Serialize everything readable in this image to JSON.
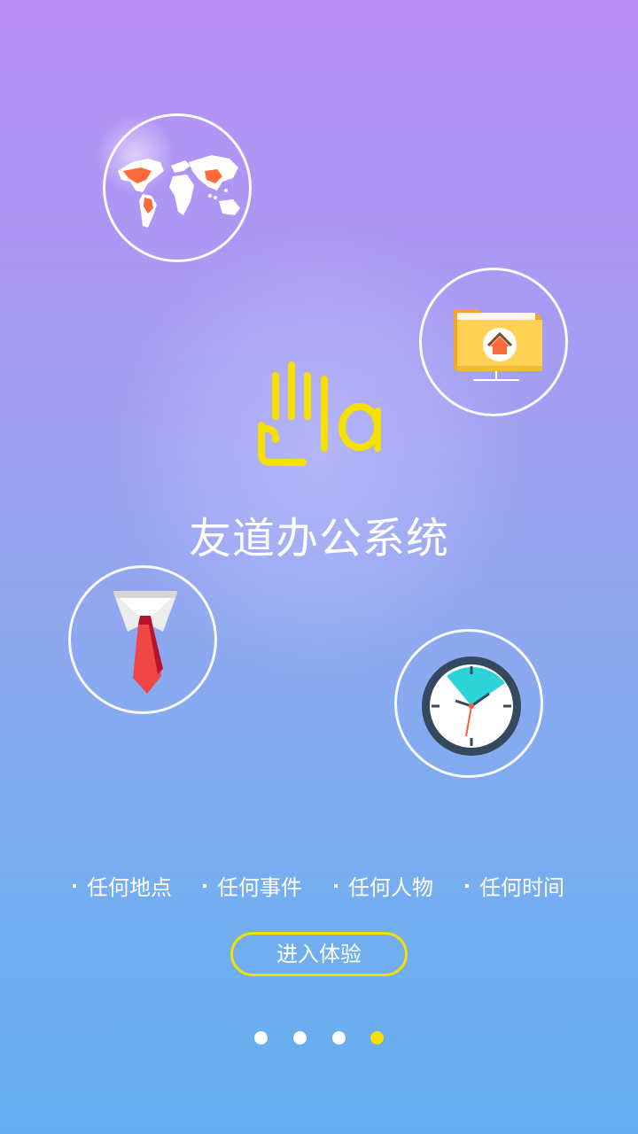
{
  "app": {
    "title": "友道办公系统"
  },
  "features": [
    {
      "label": "任何地点"
    },
    {
      "label": "任何事件"
    },
    {
      "label": "任何人物"
    },
    {
      "label": "任何时间"
    }
  ],
  "cta": {
    "label": "进入体验"
  },
  "pager": {
    "total": 4,
    "active_index": 3
  },
  "icons": {
    "world": "world-map-icon",
    "folder": "home-folder-icon",
    "tie": "tie-icon",
    "clock": "clock-icon",
    "logo": "hand-logo-icon"
  },
  "colors": {
    "accent": "#f4e100",
    "white": "#ffffff",
    "map_highlight": "#ff6a3a",
    "clock_face": "#2ed3d8",
    "tie": "#f04646"
  }
}
